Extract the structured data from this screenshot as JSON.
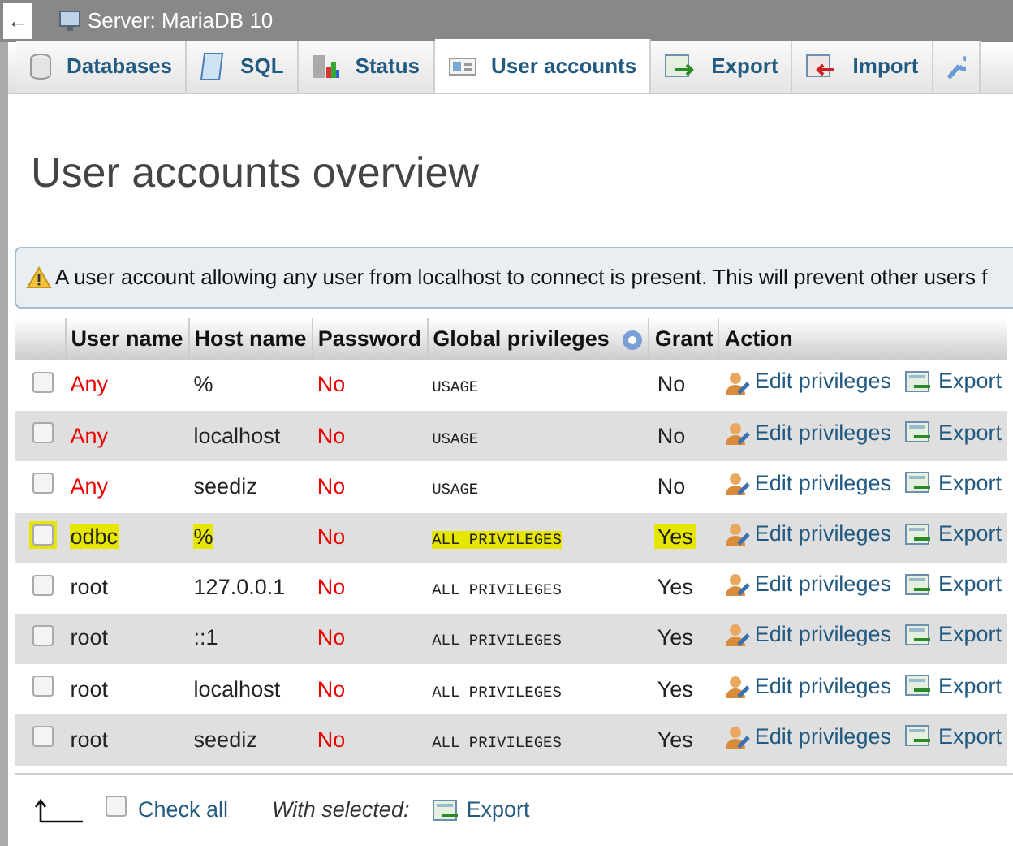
{
  "window": {
    "back": "←",
    "title": "Server: MariaDB 10"
  },
  "tabs": [
    {
      "label": "Databases",
      "selected": false
    },
    {
      "label": "SQL",
      "selected": false
    },
    {
      "label": "Status",
      "selected": false
    },
    {
      "label": "User accounts",
      "selected": true
    },
    {
      "label": "Export",
      "selected": false
    },
    {
      "label": "Import",
      "selected": false
    },
    {
      "selected": false
    }
  ],
  "heading": "User accounts overview",
  "notice": "A user account allowing any user from localhost to connect is present. This will prevent other users f",
  "table": {
    "columns": [
      "User name",
      "Host name",
      "Password",
      "Global privileges",
      "Grant",
      "Action"
    ],
    "rows": [
      {
        "user": "Any",
        "any_user": true,
        "host": "%",
        "password": "No",
        "privileges": "USAGE",
        "grant": "No",
        "edit": "Edit privileges",
        "export": "Export",
        "checked": false,
        "highlighted": false
      },
      {
        "user": "Any",
        "any_user": true,
        "host": "localhost",
        "password": "No",
        "privileges": "USAGE",
        "grant": "No",
        "edit": "Edit privileges",
        "export": "Export",
        "checked": false,
        "highlighted": false
      },
      {
        "user": "Any",
        "any_user": true,
        "host": "seediz",
        "password": "No",
        "privileges": "USAGE",
        "grant": "No",
        "edit": "Edit privileges",
        "export": "Export",
        "checked": false,
        "highlighted": false
      },
      {
        "user": "odbc",
        "any_user": false,
        "host": "%",
        "password": "No",
        "privileges": "ALL PRIVILEGES",
        "grant": "Yes",
        "edit": "Edit privileges",
        "export": "Export",
        "checked": false,
        "highlighted": true
      },
      {
        "user": "root",
        "any_user": false,
        "host": "127.0.0.1",
        "password": "No",
        "privileges": "ALL PRIVILEGES",
        "grant": "Yes",
        "edit": "Edit privileges",
        "export": "Export",
        "checked": false,
        "highlighted": false
      },
      {
        "user": "root",
        "any_user": false,
        "host": "::1",
        "password": "No",
        "privileges": "ALL PRIVILEGES",
        "grant": "Yes",
        "edit": "Edit privileges",
        "export": "Export",
        "checked": false,
        "highlighted": false
      },
      {
        "user": "root",
        "any_user": false,
        "host": "localhost",
        "password": "No",
        "privileges": "ALL PRIVILEGES",
        "grant": "Yes",
        "edit": "Edit privileges",
        "export": "Export",
        "checked": false,
        "highlighted": false
      },
      {
        "user": "root",
        "any_user": false,
        "host": "seediz",
        "password": "No",
        "privileges": "ALL PRIVILEGES",
        "grant": "Yes",
        "edit": "Edit privileges",
        "export": "Export",
        "checked": false,
        "highlighted": false
      }
    ]
  },
  "footer": {
    "check_all": "Check all",
    "checked": false,
    "with_selected": "With selected:",
    "export": "Export"
  }
}
